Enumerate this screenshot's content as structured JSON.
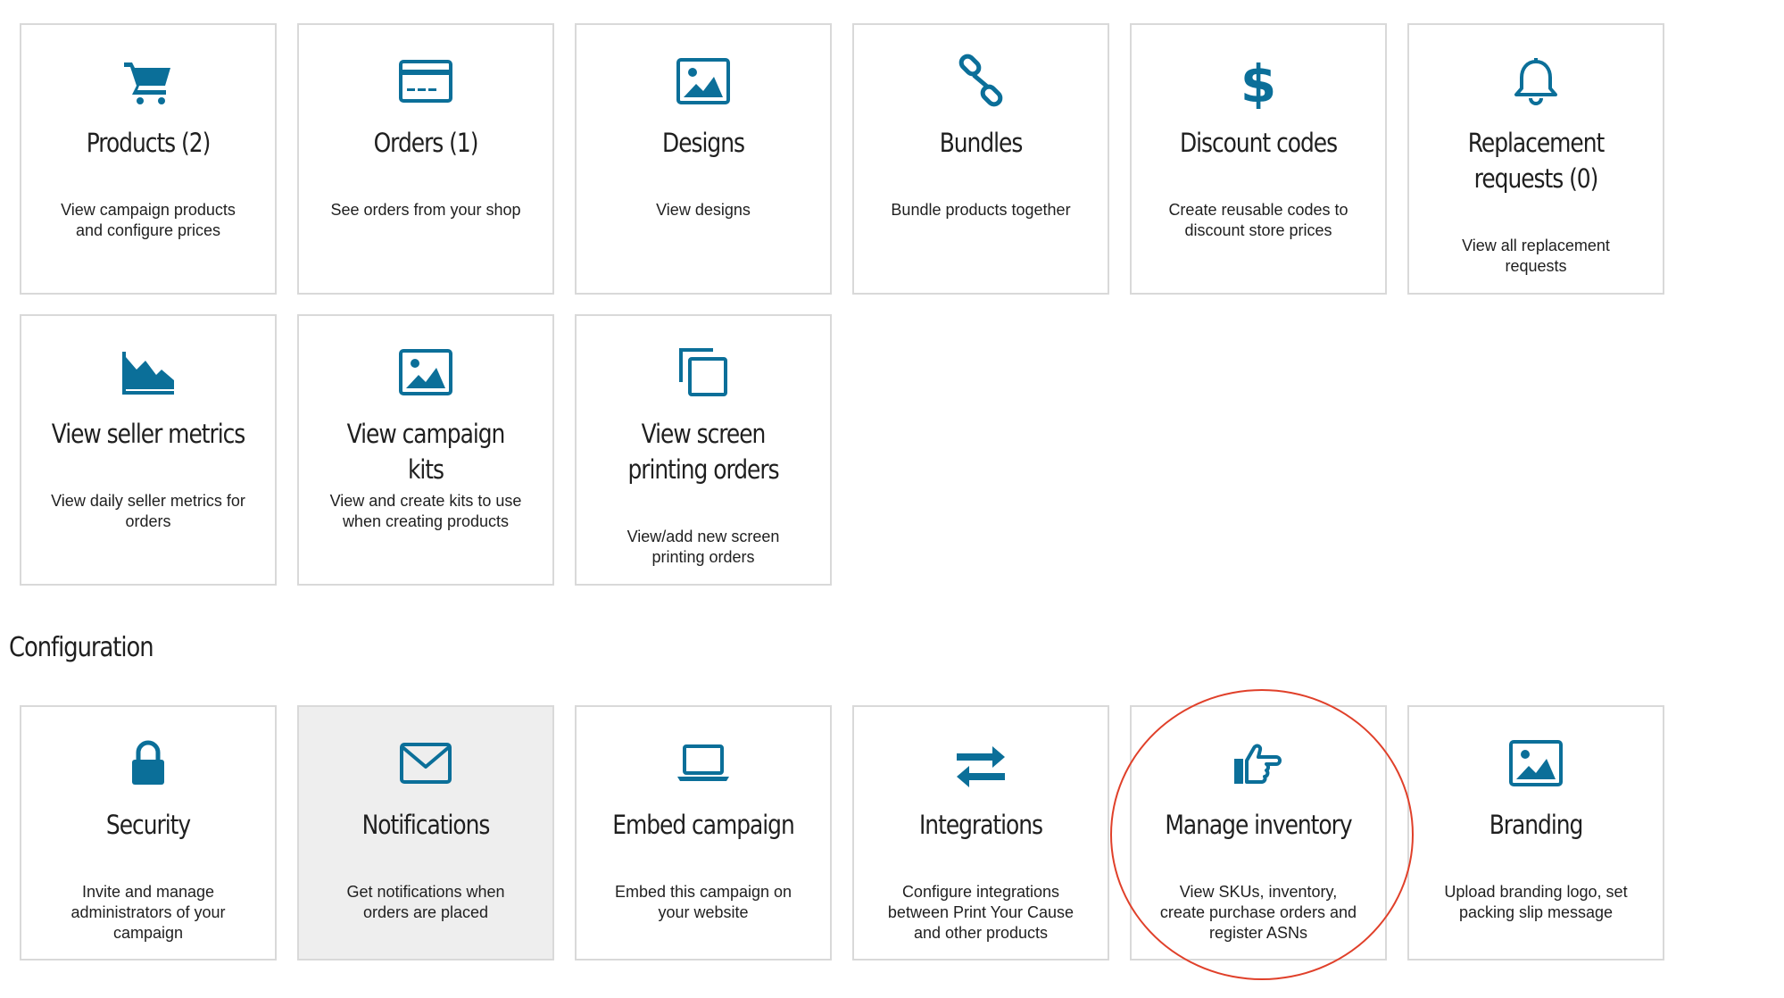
{
  "accent_color": "#0b6f99",
  "campaign_cards": [
    {
      "icon": "cart-icon",
      "title": "Products (2)",
      "description": "View campaign products and configure prices"
    },
    {
      "icon": "credit-card-icon",
      "title": "Orders (1)",
      "description": "See orders from your shop"
    },
    {
      "icon": "image-icon",
      "title": "Designs",
      "description": "View designs"
    },
    {
      "icon": "link-icon",
      "title": "Bundles",
      "description": "Bundle products together"
    },
    {
      "icon": "dollar-icon",
      "title": "Discount codes",
      "description": "Create reusable codes to discount store prices"
    },
    {
      "icon": "bell-icon",
      "title": "Replacement requests (0)",
      "description": "View all replacement requests"
    },
    {
      "icon": "area-chart-icon",
      "title": "View seller metrics",
      "description": "View daily seller metrics for orders"
    },
    {
      "icon": "image-icon",
      "title": "View campaign kits",
      "description": "View and create kits to use when creating products"
    },
    {
      "icon": "copy-icon",
      "title": "View screen printing orders",
      "description": "View/add new screen printing orders"
    }
  ],
  "configuration": {
    "section_title": "Configuration",
    "cards": [
      {
        "icon": "lock-icon",
        "title": "Security",
        "description": "Invite and manage administrators of your campaign"
      },
      {
        "icon": "envelope-icon",
        "title": "Notifications",
        "description": "Get notifications when orders are placed"
      },
      {
        "icon": "laptop-icon",
        "title": "Embed campaign",
        "description": "Embed this campaign on your website"
      },
      {
        "icon": "exchange-icon",
        "title": "Integrations",
        "description": "Configure integrations between Print Your Cause and other products"
      },
      {
        "icon": "hand-pointing-icon",
        "title": "Manage inventory",
        "description": "View SKUs, inventory, create purchase orders and register ASNs"
      },
      {
        "icon": "image-icon",
        "title": "Branding",
        "description": "Upload branding logo, set packing slip message"
      }
    ]
  },
  "annotation_color": "#e0402a"
}
